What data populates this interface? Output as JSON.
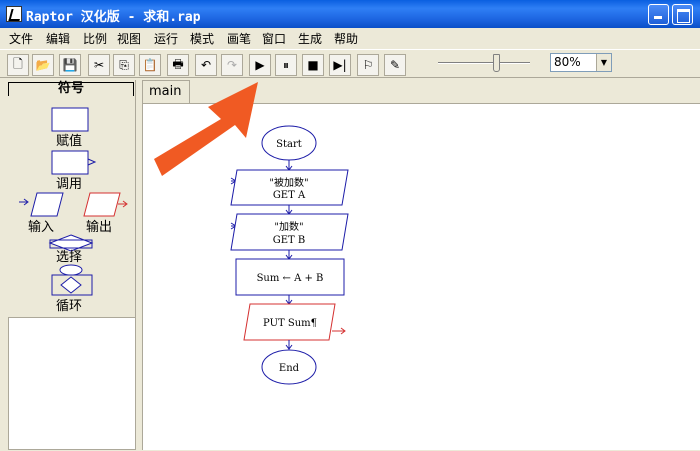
{
  "window": {
    "title": "Raptor 汉化版 - 求和.rap"
  },
  "menu": {
    "items": [
      "文件",
      "编辑",
      "比例",
      "视图",
      "运行",
      "模式",
      "画笔",
      "窗口",
      "生成",
      "帮助"
    ]
  },
  "toolbar": {
    "buttons": [
      {
        "name": "new-file-icon",
        "glyph": "🗋"
      },
      {
        "name": "open-folder-icon",
        "glyph": "📂"
      },
      {
        "name": "save-icon",
        "glyph": "💾"
      },
      {
        "name": "cut-icon",
        "glyph": "✂"
      },
      {
        "name": "copy-icon",
        "glyph": "⎘"
      },
      {
        "name": "paste-icon",
        "glyph": "📋"
      },
      {
        "name": "print-icon",
        "glyph": "🖶"
      },
      {
        "name": "undo-icon",
        "glyph": "↶"
      },
      {
        "name": "redo-icon",
        "glyph": "↷"
      },
      {
        "name": "run-icon",
        "glyph": "▶"
      },
      {
        "name": "pause-icon",
        "glyph": "⏸"
      },
      {
        "name": "stop-icon",
        "glyph": "■"
      },
      {
        "name": "step-icon",
        "glyph": "▶|"
      },
      {
        "name": "test-icon",
        "glyph": "⚐"
      },
      {
        "name": "pen-icon",
        "glyph": "✎"
      }
    ],
    "zoom_value": "80%"
  },
  "symbols": {
    "header": "符号",
    "assign": "赋值",
    "call": "调用",
    "input": "输入",
    "output": "输出",
    "select": "选择",
    "loop": "循环"
  },
  "tab": {
    "label": "main"
  },
  "flowchart": {
    "start": "Start",
    "input1_prompt": "\"被加数\"",
    "input1_get": "GET A",
    "input2_prompt": "\"加数\"",
    "input2_get": "GET B",
    "assign": "Sum ← A + B",
    "output": "PUT Sum¶",
    "end": "End"
  },
  "colors": {
    "flow_blue": "#1c1ca8",
    "output_red": "#d43030",
    "arrow_orange": "#f05a23"
  }
}
